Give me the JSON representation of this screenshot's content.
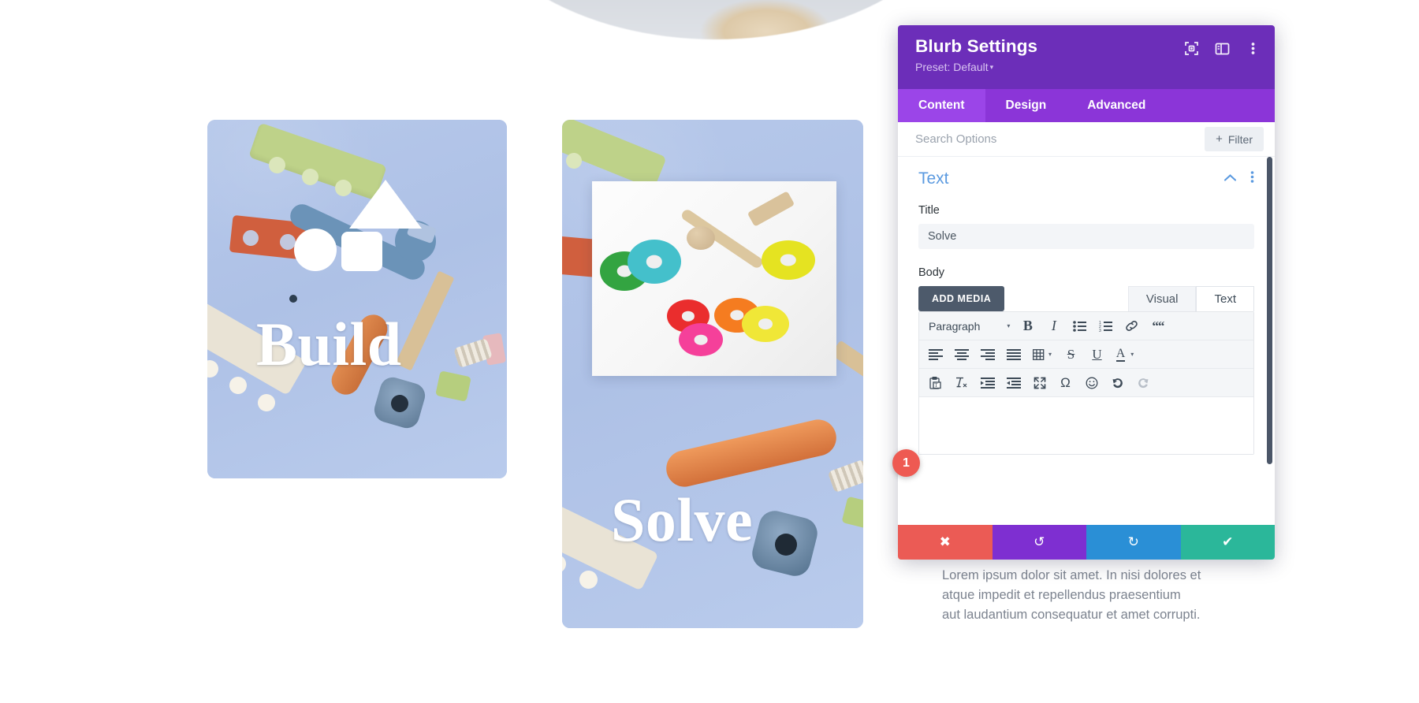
{
  "panel": {
    "title": "Blurb Settings",
    "preset": "Preset: Default",
    "preset_caret": "▾",
    "icons": {
      "focus": "focus-frame-icon",
      "layout": "panel-layout-icon",
      "more": "more-vertical-icon"
    },
    "tabs": [
      {
        "label": "Content",
        "active": true
      },
      {
        "label": "Design",
        "active": false
      },
      {
        "label": "Advanced",
        "active": false
      }
    ],
    "search_placeholder": "Search Options",
    "filter_label": "Filter",
    "filter_plus": "+",
    "section": {
      "title": "Text",
      "collapse_icon": "chevron-up-icon",
      "more_icon": "more-vertical-icon"
    },
    "fields": {
      "title_label": "Title",
      "title_value": "Solve",
      "body_label": "Body"
    },
    "editor": {
      "add_media": "ADD MEDIA",
      "visual_tab": "Visual",
      "text_tab": "Text",
      "format_select": "Paragraph",
      "format_caret": "▾",
      "row1": [
        {
          "name": "bold-icon",
          "glyph": "B"
        },
        {
          "name": "italic-icon",
          "glyph": "I"
        },
        {
          "name": "bullet-list-icon",
          "glyph": ""
        },
        {
          "name": "numbered-list-icon",
          "glyph": ""
        },
        {
          "name": "link-icon",
          "glyph": ""
        },
        {
          "name": "blockquote-icon",
          "glyph": ""
        }
      ],
      "row2": [
        {
          "name": "align-left-icon"
        },
        {
          "name": "align-center-icon"
        },
        {
          "name": "align-right-icon"
        },
        {
          "name": "align-justify-icon"
        },
        {
          "name": "table-icon"
        },
        {
          "name": "strikethrough-icon",
          "glyph": "S"
        },
        {
          "name": "underline-icon",
          "glyph": "U"
        },
        {
          "name": "text-color-icon",
          "glyph": "A"
        }
      ],
      "row3": [
        {
          "name": "paste-as-text-icon"
        },
        {
          "name": "clear-formatting-icon"
        },
        {
          "name": "outdent-icon"
        },
        {
          "name": "indent-icon"
        },
        {
          "name": "fullscreen-icon"
        },
        {
          "name": "special-character-icon",
          "glyph": "Ω"
        },
        {
          "name": "emoji-icon",
          "glyph": "☺"
        },
        {
          "name": "undo-icon"
        },
        {
          "name": "redo-icon"
        }
      ],
      "body_value": ""
    },
    "footer": {
      "cancel": "✖",
      "undo": "↺",
      "redo": "↻",
      "save": "✔"
    },
    "colors": {
      "header": "#6c2eb9",
      "tabbar": "#8b35d8",
      "tab_active": "#9b45e8",
      "section_title": "#5b9ae0",
      "cancel": "#eb5b55",
      "undo": "#7e2fd1",
      "redo": "#2a8fd6",
      "save": "#2bb79a",
      "badge": "#ee5a52",
      "card_bg": "#b3c6e8"
    }
  },
  "badge": {
    "number": "1"
  },
  "cards": [
    {
      "title": "Build",
      "bg": "#b3c6e8"
    },
    {
      "title": "Solve",
      "bg": "#b3c6e8"
    }
  ],
  "blurb_body": "Lorem ipsum dolor sit amet. In nisi dolores et atque impedit et repellendus praesentium aut laudantium consequatur et amet corrupti."
}
